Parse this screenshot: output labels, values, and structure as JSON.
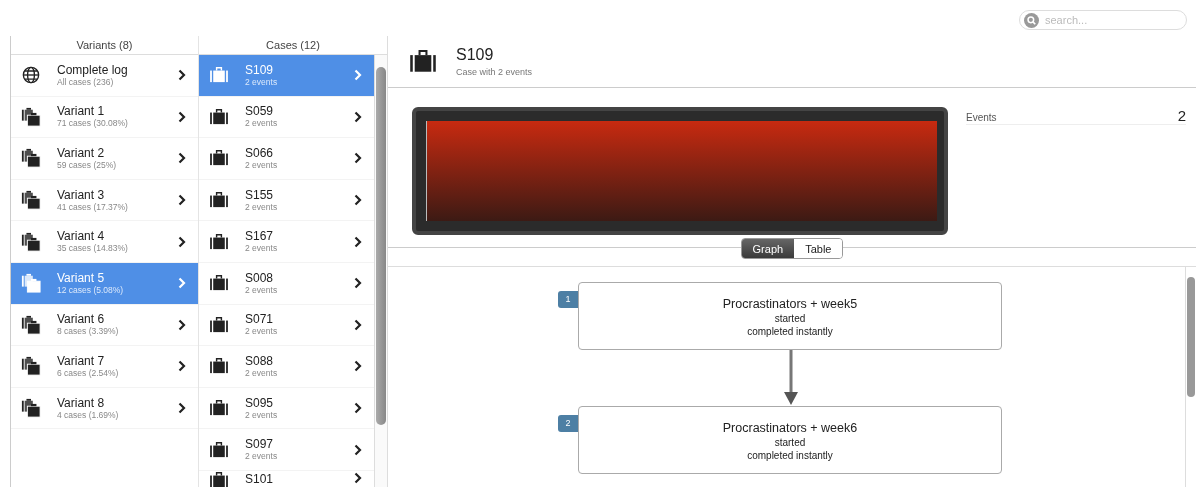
{
  "search": {
    "placeholder": "search..."
  },
  "variants": {
    "title": "Variants (8)",
    "items": [
      {
        "name": "Complete log",
        "detail": "All cases (236)",
        "kind": "log",
        "selected": false
      },
      {
        "name": "Variant 1",
        "detail": "71 cases (30.08%)",
        "kind": "variant",
        "selected": false
      },
      {
        "name": "Variant 2",
        "detail": "59 cases (25%)",
        "kind": "variant",
        "selected": false
      },
      {
        "name": "Variant 3",
        "detail": "41 cases (17.37%)",
        "kind": "variant",
        "selected": false
      },
      {
        "name": "Variant 4",
        "detail": "35 cases (14.83%)",
        "kind": "variant",
        "selected": false
      },
      {
        "name": "Variant 5",
        "detail": "12 cases (5.08%)",
        "kind": "variant",
        "selected": true
      },
      {
        "name": "Variant 6",
        "detail": "8 cases (3.39%)",
        "kind": "variant",
        "selected": false
      },
      {
        "name": "Variant 7",
        "detail": "6 cases (2.54%)",
        "kind": "variant",
        "selected": false
      },
      {
        "name": "Variant 8",
        "detail": "4 cases (1.69%)",
        "kind": "variant",
        "selected": false
      }
    ]
  },
  "cases": {
    "title": "Cases (12)",
    "items": [
      {
        "name": "S109",
        "detail": "2 events",
        "selected": true
      },
      {
        "name": "S059",
        "detail": "2 events",
        "selected": false
      },
      {
        "name": "S066",
        "detail": "2 events",
        "selected": false
      },
      {
        "name": "S155",
        "detail": "2 events",
        "selected": false
      },
      {
        "name": "S167",
        "detail": "2 events",
        "selected": false
      },
      {
        "name": "S008",
        "detail": "2 events",
        "selected": false
      },
      {
        "name": "S071",
        "detail": "2 events",
        "selected": false
      },
      {
        "name": "S088",
        "detail": "2 events",
        "selected": false
      },
      {
        "name": "S095",
        "detail": "2 events",
        "selected": false
      },
      {
        "name": "S097",
        "detail": "2 events",
        "selected": false
      },
      {
        "name": "S101",
        "selected": false
      }
    ]
  },
  "case": {
    "title": "S109",
    "subtitle": "Case with 2 events",
    "stats": [
      {
        "label": "Events",
        "value": "2"
      }
    ]
  },
  "view_toggle": [
    {
      "label": "Graph",
      "selected": true
    },
    {
      "label": "Table",
      "selected": false
    }
  ],
  "events": [
    {
      "number": "1",
      "activity": "Procrastinators + week5",
      "lines": [
        "started",
        "completed instantly"
      ]
    },
    {
      "number": "2",
      "activity": "Procrastinators + week6",
      "lines": [
        "started",
        "completed instantly"
      ]
    }
  ]
}
